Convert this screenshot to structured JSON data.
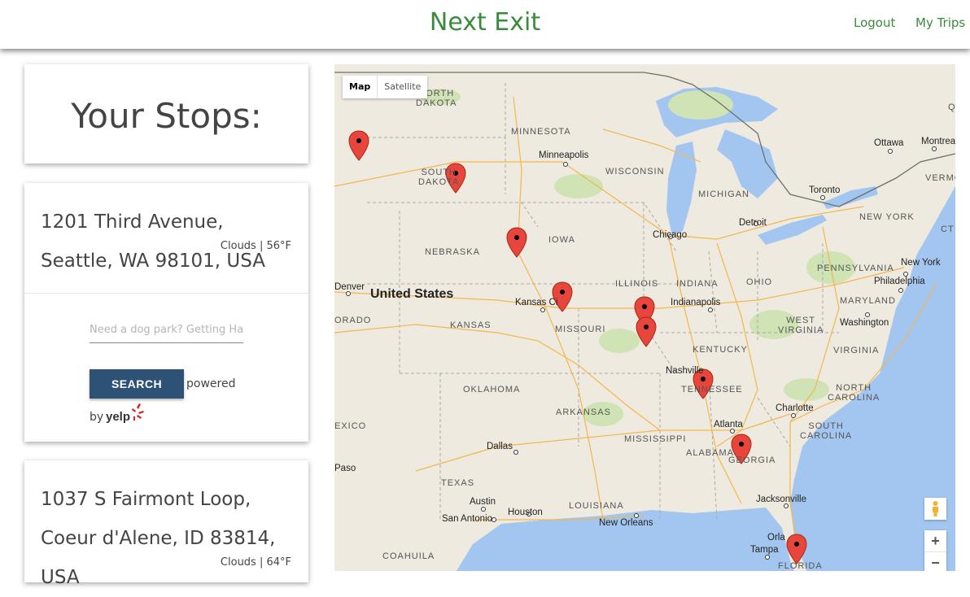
{
  "app": {
    "brand": "Next Exit",
    "nav": {
      "logout": "Logout",
      "my_trips": "My Trips"
    }
  },
  "sidebar": {
    "title": "Your Stops:",
    "stops": [
      {
        "address": "1201 Third Avenue, Seattle, WA 98101, USA",
        "weather": "Clouds | 56°F",
        "search": {
          "placeholder": "Need a dog park? Getting Har",
          "button_label": "SEARCH",
          "powered_text": "powered",
          "by_text": "by",
          "yelp_logo": "yelp"
        }
      },
      {
        "address": "1037 S Fairmont Loop, Coeur d'Alene, ID 83814, USA",
        "weather": "Clouds | 64°F"
      }
    ]
  },
  "map": {
    "type_controls": {
      "map": "Map",
      "satellite": "Satellite"
    },
    "zoom": {
      "in": "+",
      "out": "−"
    },
    "pegman_icon": "pegman-icon",
    "marker_icon": "map-pin-icon",
    "labels": {
      "north_dakota": "NORTH\nDAKOTA",
      "minnesota": "MINNESOTA",
      "south_dakota": "SOUTH\nDAKOTA",
      "wisconsin": "WISCONSIN",
      "michigan": "MICHIGAN",
      "nebraska": "NEBRASKA",
      "iowa": "IOWA",
      "illinois": "ILLINOIS",
      "indiana": "INDIANA",
      "ohio": "OHIO",
      "pennsylvania": "PENNSYLVANIA",
      "new_york": "NEW YORK",
      "kansas": "KANSAS",
      "missouri": "MISSOURI",
      "kentucky": "KENTUCKY",
      "west_virginia": "WEST\nVIRGINIA",
      "virginia": "VIRGINIA",
      "maryland": "MARYLAND",
      "tennessee": "TENNESSEE",
      "north_carolina": "NORTH\nCAROLINA",
      "south_carolina": "SOUTH\nCAROLINA",
      "oklahoma": "OKLAHOMA",
      "arkansas": "ARKANSAS",
      "mississippi": "MISSISSIPPI",
      "alabama": "ALABAMA",
      "georgia": "GEORGIA",
      "texas": "TEXAS",
      "louisiana": "LOUISIANA",
      "florida": "FLORIDA",
      "coahuila": "COAHUILA",
      "mexico": "EXICO",
      "orado": "ORADO",
      "vermont": "VERMO",
      "ct": "CT",
      "q": "Q",
      "us": "United States",
      "minneapolis": "Minneapolis",
      "chicago": "Chicago",
      "detroit": "Detroit",
      "toronto": "Toronto",
      "ottawa": "Ottawa",
      "montreal": "Montreal",
      "new_york_city": "New York",
      "philadelphia": "Philadelphia",
      "washington": "Washington",
      "indianapolis": "Indianapolis",
      "kansas_city": "Kansas Ci",
      "denver": "Denver",
      "nashville": "Nashville",
      "atlanta": "Atlanta",
      "charlotte": "Charlotte",
      "dallas": "Dallas",
      "austin": "Austin",
      "san_antonio": "San Antonio",
      "houston": "Houston",
      "new_orleans": "New Orleans",
      "jacksonville": "Jacksonville",
      "tampa": "Tampa",
      "orlando": "Orla",
      "el_paso": "Paso"
    }
  }
}
